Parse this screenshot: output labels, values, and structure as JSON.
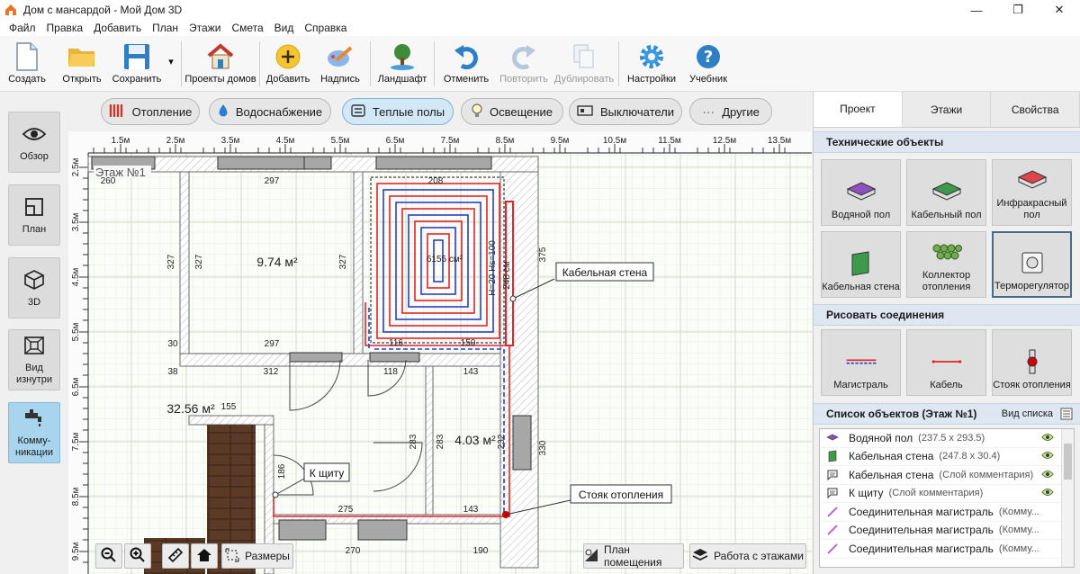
{
  "window": {
    "title": "Дом с мансардой - Мой Дом 3D",
    "minimize": "—",
    "maximize": "❐",
    "close": "✕"
  },
  "menu": [
    "Файл",
    "Правка",
    "Добавить",
    "План",
    "Этажи",
    "Смета",
    "Вид",
    "Справка"
  ],
  "toolbar": {
    "create": "Создать",
    "open": "Открыть",
    "save": "Сохранить",
    "projects": "Проекты домов",
    "add": "Добавить",
    "caption": "Надпись",
    "landscape": "Ландшафт",
    "undo": "Отменить",
    "redo": "Повторить",
    "duplicate": "Дублировать",
    "settings": "Настройки",
    "tutorial": "Учебник"
  },
  "leftbar": {
    "overview": "Обзор",
    "plan": "План",
    "view3d": "3D",
    "inside": "Вид изнутри",
    "comms": "Комму-никации"
  },
  "categories": {
    "heating": "Отопление",
    "water": "Водоснабжение",
    "warmfloor": "Теплые полы",
    "lighting": "Освещение",
    "switches": "Выключатели",
    "other": "Другие"
  },
  "canvas": {
    "ruler_x": [
      "1.5м",
      "2.5м",
      "3.5м",
      "4.5м",
      "5.5м",
      "6.5м",
      "7.5м",
      "8.5м",
      "9.5м",
      "10.5м",
      "11.5м",
      "12.5м",
      "13.5м"
    ],
    "ruler_y": [
      "2.5м",
      "3.5м",
      "4.5м",
      "5.5м",
      "6.5м",
      "7.5м",
      "8.5м",
      "9.5м"
    ],
    "floor_label": "Этаж №1",
    "room1_area": "9.74 м²",
    "room2_area": "4.03 м²",
    "hall_area": "32.56 м²",
    "heat_area": "6155 см²",
    "heat_h": "H=20 Hs=100",
    "heat_len": "248 см",
    "dims": {
      "d260": "260",
      "d297a": "297",
      "d297b": "297",
      "d327a": "327",
      "d327b": "327",
      "d327c": "327",
      "d30": "30",
      "d38": "38",
      "d312": "312",
      "d118": "118",
      "d143a": "143",
      "d143b": "143",
      "d208": "208",
      "d375": "375",
      "d116": "116",
      "d150": "150",
      "d283a": "283",
      "d283b": "283",
      "d330": "330",
      "d155": "155",
      "d186": "186",
      "d275": "275",
      "d270": "270",
      "d190": "190",
      "d232": "232"
    },
    "callout_wall": "Кабельная стена",
    "callout_shield": "К щиту",
    "callout_riser": "Стояк отопления",
    "btn_sizes": "Размеры",
    "btn_room_plan": "План помещения",
    "btn_floors": "Работа с этажами"
  },
  "right": {
    "tabs": [
      "Проект",
      "Этажи",
      "Свойства"
    ],
    "tech_title": "Технические объекты",
    "tech": [
      "Водяной пол",
      "Кабельный пол",
      "Инфракрасный пол",
      "Кабельная стена",
      "Коллектор отопления",
      "Терморегулятор"
    ],
    "conn_title": "Рисовать соединения",
    "conn": [
      "Магистраль",
      "Кабель",
      "Стояк отопления"
    ],
    "list_title": "Список объектов (Этаж №1)",
    "list_view": "Вид списка",
    "items": [
      {
        "name": "Водяной пол",
        "sub": "(237.5 x 293.5)"
      },
      {
        "name": "Кабельная стена",
        "sub": "(247.8 x 30.4)"
      },
      {
        "name": "Кабельная стена",
        "sub": "(Слой комментария)"
      },
      {
        "name": "К щиту",
        "sub": "(Слой комментария)"
      },
      {
        "name": "Соединительная магистраль",
        "sub": "(Комму..."
      },
      {
        "name": "Соединительная магистраль",
        "sub": "(Комму..."
      },
      {
        "name": "Соединительная магистраль",
        "sub": "(Комму..."
      }
    ]
  },
  "colors": {
    "accent": "#a9d4ee",
    "heat_red": "#e0262a",
    "heat_blue": "#2a3ec8",
    "section": "#dde6f1"
  }
}
